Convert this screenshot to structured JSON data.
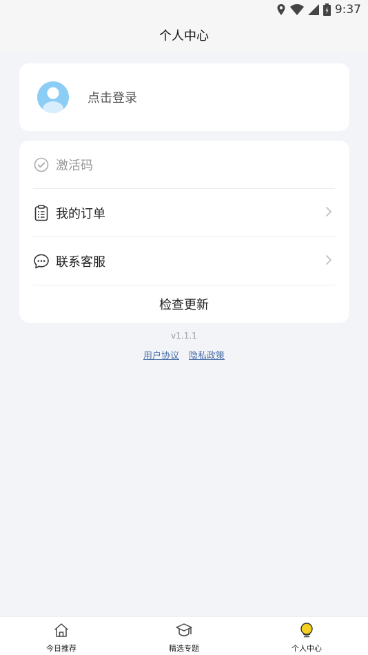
{
  "status": {
    "time": "9:37"
  },
  "header": {
    "title": "个人中心"
  },
  "login": {
    "label": "点击登录"
  },
  "menu": {
    "items": [
      {
        "label": "激活码"
      },
      {
        "label": "我的订单"
      },
      {
        "label": "联系客服"
      }
    ],
    "check_update_label": "检查更新"
  },
  "footer": {
    "version": "v1.1.1",
    "user_agreement": "用户协议",
    "privacy_policy": "隐私政策"
  },
  "tabs": [
    {
      "label": "今日推荐",
      "icon": "home-icon"
    },
    {
      "label": "精选专题",
      "icon": "graduation-cap-icon"
    },
    {
      "label": "个人中心",
      "icon": "bulb-icon",
      "active": true
    }
  ],
  "colors": {
    "accent": "#f5d020",
    "avatar": "#8ccdf6",
    "link": "#4a6fa8",
    "background": "#f3f4f8"
  }
}
